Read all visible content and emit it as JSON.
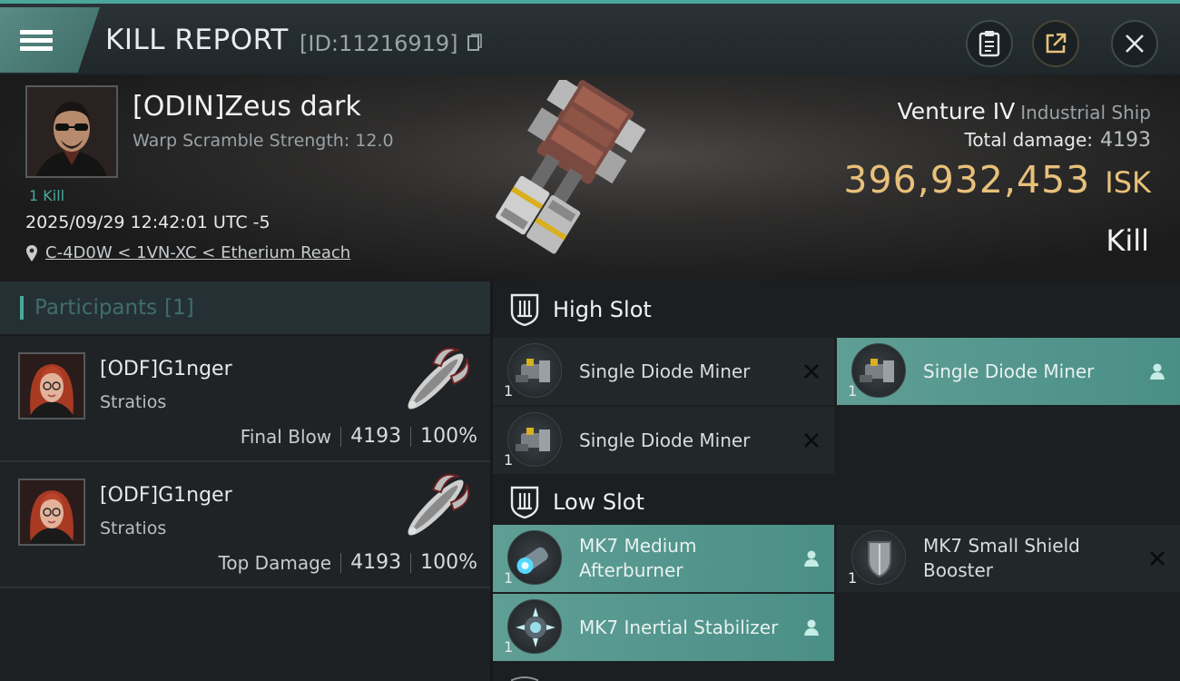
{
  "header": {
    "title": "KILL REPORT",
    "report_id": "[ID:11216919]",
    "icons": [
      "menu-icon",
      "copy-icon",
      "clipboard-icon",
      "share-icon",
      "close-icon"
    ]
  },
  "victim": {
    "name": "[ODIN]Zeus dark",
    "warp_scramble": "Warp Scramble Strength: 12.0",
    "kills": "1 Kill",
    "datetime": "2025/09/29 12:42:01 UTC -5",
    "location": "C-4D0W < 1VN-XC < Etherium Reach",
    "ship_name": "Venture IV",
    "ship_class": "Industrial Ship",
    "total_damage_label": "Total damage:",
    "total_damage": "4193",
    "isk_value": "396,932,453",
    "isk_unit": "ISK",
    "result": "Kill"
  },
  "participants": {
    "label": "Participants",
    "count": "[1]",
    "rows": [
      {
        "name": "[ODF]G1nger",
        "ship": "Stratios",
        "role": "Final Blow",
        "damage": "4193",
        "percent": "100%"
      },
      {
        "name": "[ODF]G1nger",
        "ship": "Stratios",
        "role": "Top Damage",
        "damage": "4193",
        "percent": "100%"
      }
    ]
  },
  "slots": {
    "high": {
      "label": "High Slot",
      "modules": [
        {
          "name": "Single Diode Miner",
          "qty": "1",
          "state": "destroyed"
        },
        {
          "name": "Single Diode Miner",
          "qty": "1",
          "state": "dropped"
        },
        {
          "name": "Single Diode Miner",
          "qty": "1",
          "state": "destroyed"
        }
      ]
    },
    "low": {
      "label": "Low Slot",
      "modules": [
        {
          "name": "MK7 Medium Afterburner",
          "line1": "MK7 Medium",
          "line2": "Afterburner",
          "qty": "1",
          "state": "dropped"
        },
        {
          "name": "MK7 Small Shield Booster",
          "line1": "MK7 Small Shield",
          "line2": "Booster",
          "qty": "1",
          "state": "destroyed"
        },
        {
          "name": "MK7 Inertial Stabilizer",
          "qty": "1",
          "state": "dropped"
        }
      ]
    }
  },
  "colors": {
    "accent": "#4aa89b",
    "isk": "#e8c07a",
    "dropped_bg": "#5a9a91",
    "destroyed_bg": "#22272a"
  }
}
